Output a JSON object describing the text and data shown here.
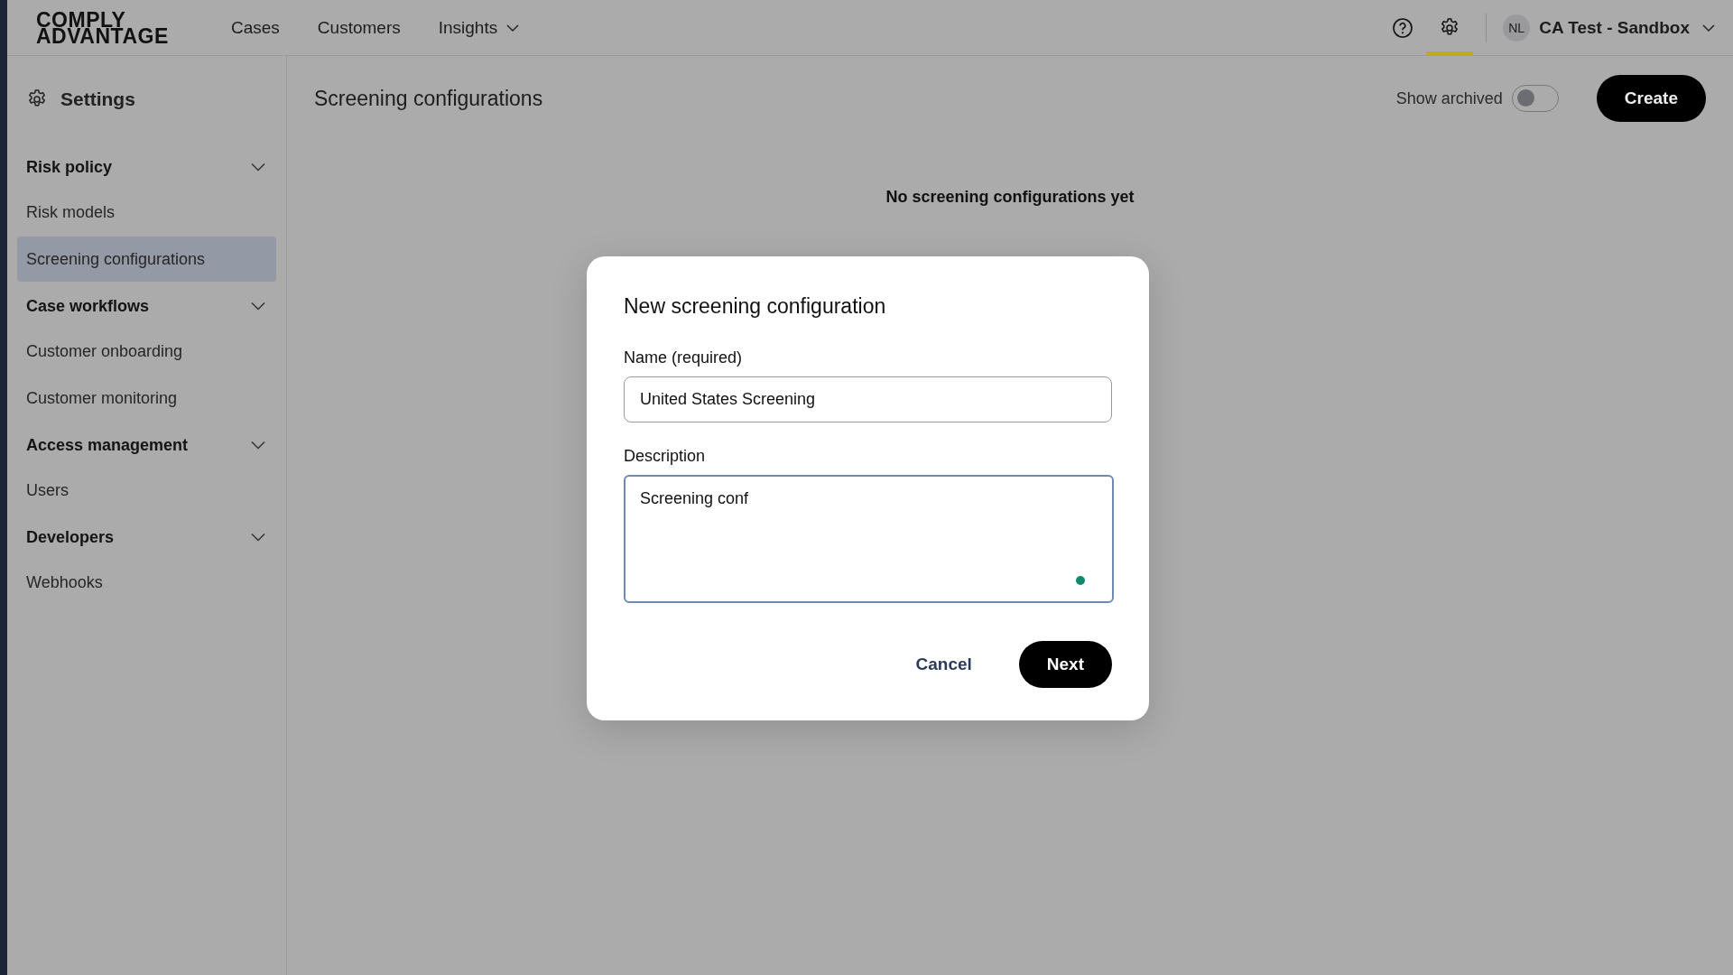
{
  "logo": {
    "line1": "COMPLY",
    "line2": "ADVANTAGE"
  },
  "nav": [
    {
      "label": "Cases",
      "has_menu": false
    },
    {
      "label": "Customers",
      "has_menu": false
    },
    {
      "label": "Insights",
      "has_menu": true
    }
  ],
  "header_icons": [
    {
      "kind": "help",
      "selected": false
    },
    {
      "kind": "settings",
      "selected": true
    }
  ],
  "account": {
    "initials": "NL",
    "name": "CA Test - Sandbox"
  },
  "sidebar": {
    "title": "Settings",
    "sections": [
      {
        "label": "Risk policy",
        "expanded": true,
        "items": [
          {
            "label": "Risk models",
            "selected": false
          },
          {
            "label": "Screening configurations",
            "selected": true
          }
        ]
      },
      {
        "label": "Case workflows",
        "expanded": true,
        "items": [
          {
            "label": "Customer onboarding",
            "selected": false
          },
          {
            "label": "Customer monitoring",
            "selected": false
          }
        ]
      },
      {
        "label": "Access management",
        "expanded": true,
        "items": [
          {
            "label": "Users",
            "selected": false
          }
        ]
      },
      {
        "label": "Developers",
        "expanded": true,
        "items": [
          {
            "label": "Webhooks",
            "selected": false
          }
        ]
      }
    ]
  },
  "page": {
    "title": "Screening configurations",
    "show_archived": {
      "label": "Show archived",
      "on": false
    },
    "create_button": "Create",
    "empty_title": "No screening configurations yet"
  },
  "dialog": {
    "title": "New screening configuration",
    "name_field": {
      "label": "Name (required)",
      "value": "United States Screening"
    },
    "description_field": {
      "label": "Description",
      "value": "Screening conf",
      "focused": true
    },
    "cancel_button": "Cancel",
    "next_button": "Next"
  }
}
